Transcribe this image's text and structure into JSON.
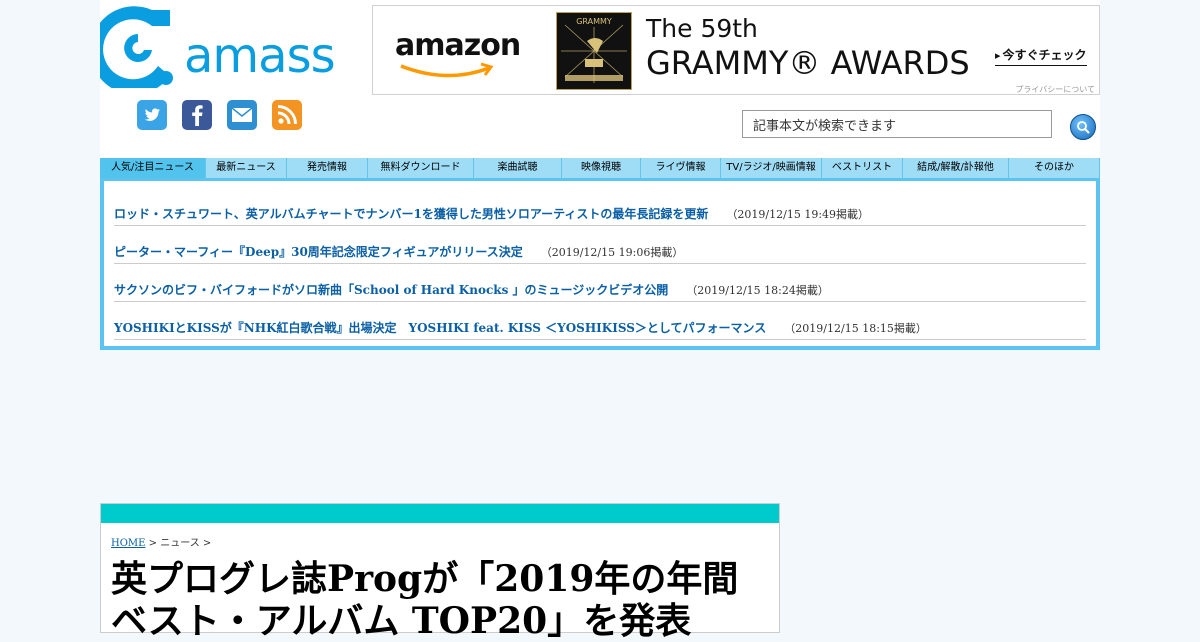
{
  "header": {
    "logo_text": "amass",
    "social_icons": [
      {
        "name": "twitter-icon",
        "color": "#3aa4e6"
      },
      {
        "name": "facebook-icon",
        "color": "#3b5998"
      },
      {
        "name": "mail-icon",
        "color": "#2e8fd1"
      },
      {
        "name": "rss-icon",
        "color": "#f29322"
      }
    ]
  },
  "banner": {
    "brand": "amazon",
    "badge_text": "GRAMMY",
    "line1": "The 59th",
    "line2": "GRAMMY® AWARDS",
    "cta": "今すぐチェック",
    "privacy": "プライバシーについて"
  },
  "search": {
    "placeholder": "記事本文が検索できます"
  },
  "nav": {
    "tabs": [
      {
        "label": "人気/注目ニュース",
        "active": true
      },
      {
        "label": "最新ニュース"
      },
      {
        "label": "発売情報"
      },
      {
        "label": "無料ダウンロード"
      },
      {
        "label": "楽曲試聴"
      },
      {
        "label": "映像視聴"
      },
      {
        "label": "ライヴ情報"
      },
      {
        "label": "TV/ラジオ/映画情報"
      },
      {
        "label": "ベストリスト"
      },
      {
        "label": "結成/解散/訃報他"
      },
      {
        "label": "そのほか"
      }
    ]
  },
  "news": {
    "items": [
      {
        "title": "ロッド・スチュワート、英アルバムチャートでナンバー1を獲得した男性ソロアーティストの最年長記録を更新",
        "date": "（2019/12/15 19:49掲載）"
      },
      {
        "title": "ピーター・マーフィー『Deep』30周年記念限定フィギュアがリリース決定",
        "date": "（2019/12/15 19:06掲載）"
      },
      {
        "title": "サクソンのビフ・バイフォードがソロ新曲「School of Hard Knocks 」のミュージックビデオ公開",
        "date": "（2019/12/15 18:24掲載）"
      },
      {
        "title": "YOSHIKIとKISSが『NHK紅白歌合戦』出場決定　YOSHIKI feat. KISS ＜YOSHIKISS＞としてパフォーマンス",
        "date": "（2019/12/15 18:15掲載）"
      }
    ]
  },
  "article": {
    "breadcrumb_home": "HOME",
    "breadcrumb_rest": " > ニュース >",
    "title": "英プログレ誌Progが「2019年の年間ベスト・アルバム TOP20」を発表"
  }
}
